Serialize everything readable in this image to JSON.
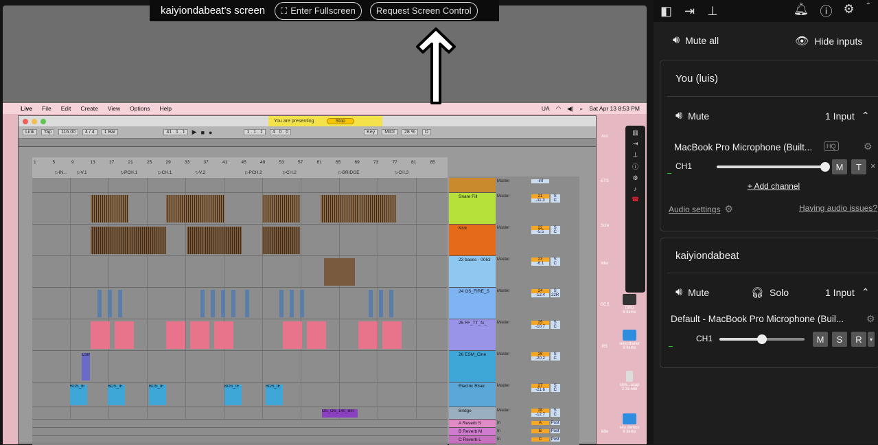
{
  "shared": {
    "title": "kaiyiondabeat's screen",
    "fullscreen_label": "Enter Fullscreen",
    "control_label": "Request Screen Control"
  },
  "macbar": {
    "app": "Live",
    "menus": [
      "File",
      "Edit",
      "Create",
      "View",
      "Options",
      "Help"
    ],
    "status_extra": "UA",
    "datetime": "Sat Apr 13  8:53 PM"
  },
  "ableton": {
    "presenting_text": "You are presenting",
    "stop_label": "Stop",
    "link": "Link",
    "tap": "Tap",
    "bpm": "116.00",
    "signature": "4 / 4",
    "quant": "1 Bar",
    "position": "41 .  1 .  1",
    "loop_start": "1 .  1 .  1",
    "loop_len": "4 .  0 .  0",
    "key": "Key",
    "midi": "MIDI",
    "cpu": "28 %",
    "d": "D",
    "sections": [
      "IN...",
      "V.1",
      "PCH.1",
      "CH.1",
      "V.2",
      "PCH.2",
      "CH.2",
      "BRIDGE",
      "CH.3"
    ],
    "bar_numbers": [
      "1",
      "5",
      "9",
      "13",
      "17",
      "21",
      "25",
      "29",
      "33",
      "37",
      "41",
      "45",
      "49",
      "53",
      "57",
      "61",
      "65",
      "69",
      "73",
      "77",
      "81",
      "85"
    ],
    "tracks": [
      {
        "name": "",
        "num": "",
        "val": ""
      },
      {
        "name": "Snare Fill",
        "num": "21",
        "val": "-11.3"
      },
      {
        "name": "Kick",
        "num": "22",
        "val": "-5.5"
      },
      {
        "name": "23 bases - 0063",
        "num": "23",
        "val": "-6.1"
      },
      {
        "name": "24 OS_FIRE_S",
        "num": "24",
        "val": "-12.4"
      },
      {
        "name": "25 FF_TT_fx_",
        "num": "25",
        "val": "-10.7"
      },
      {
        "name": "26 ESM_Cine",
        "num": "26",
        "val": "-20.2"
      },
      {
        "name": "Electric Riser",
        "num": "27",
        "val": "-21.6"
      },
      {
        "name": "Bridge",
        "num": "28",
        "val": "-12.7"
      },
      {
        "name": "A Reverb S",
        "num": "A",
        "val": ""
      },
      {
        "name": "B Reverb M",
        "num": "B",
        "val": ""
      },
      {
        "name": "C Reverb L",
        "num": "C",
        "val": ""
      }
    ],
    "io_master": "Master",
    "io_in": "In",
    "io_auto": "Auto",
    "io_off": "Off",
    "inf": "-inf",
    "s": "S",
    "c": "C",
    "post": "Post",
    "r22": "22R",
    "clip_labels": {
      "esm": "ESM",
      "bos": "BOS_IE",
      "os": "OS_OS_140_Bm"
    }
  },
  "desktop": {
    "items": [
      "DRU",
      "6 items",
      "selectballer",
      "9 items",
      "sitm...ucap",
      "2.31 MB",
      "situ demos",
      "6 items",
      "Acc",
      "ETS",
      "Scre",
      "lider",
      "OCS",
      "RS",
      "lidle"
    ]
  },
  "panel": {
    "mute_all": "Mute all",
    "hide_inputs": "Hide inputs",
    "you": {
      "name": "You (luis)",
      "mute": "Mute",
      "inputs": "1 Input",
      "device": "MacBook Pro Microphone (Built...",
      "hq": "HQ",
      "channel": "CH1",
      "level": 1.0,
      "m": "M",
      "t": "T",
      "x": "×",
      "add_channel": "+ Add channel",
      "audio_settings": "Audio settings",
      "audio_issues": "Having audio issues?"
    },
    "other": {
      "name": "kaiyiondabeat",
      "mute": "Mute",
      "solo": "Solo",
      "inputs": "1 Input",
      "device": "Default - MacBook Pro Microphone (Buil...",
      "channel": "CH1",
      "level": 0.5,
      "m": "M",
      "s": "S",
      "r": "R"
    }
  },
  "colors": {
    "accent": "#ffffff",
    "panel_bg": "#1e1e1e",
    "presenting": "#f4e24a",
    "clip_pink": "#e8748c",
    "clip_blue": "#3fa6d8"
  }
}
